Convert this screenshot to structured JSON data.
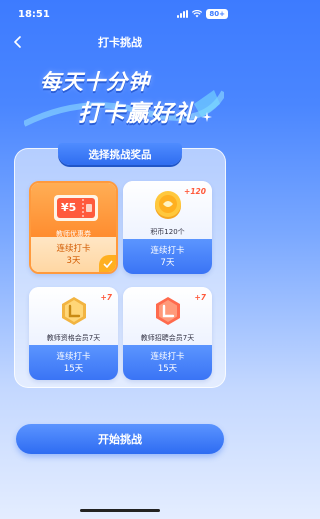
{
  "status_bar": {
    "time": "18:51",
    "battery": "80+"
  },
  "nav": {
    "title": "打卡挑战"
  },
  "banner": {
    "line1": "每天十分钟",
    "line2": "打卡赢好礼"
  },
  "panel": {
    "header": "选择挑战奖品"
  },
  "rewards": [
    {
      "name": "教师优惠券",
      "icon_text": "¥5",
      "streak_label": "连续打卡",
      "days": "3天",
      "plus": "",
      "selected": true
    },
    {
      "name": "积币120个",
      "icon_text": "",
      "streak_label": "连续打卡",
      "days": "7天",
      "plus": "+120",
      "selected": false
    },
    {
      "name": "教师资格会员7天",
      "icon_text": "",
      "streak_label": "连续打卡",
      "days": "15天",
      "plus": "+7",
      "selected": false
    },
    {
      "name": "教师招聘会员7天",
      "icon_text": "",
      "streak_label": "连续打卡",
      "days": "15天",
      "plus": "+7",
      "selected": false
    }
  ],
  "start_button": {
    "label": "开始挑战"
  },
  "colors": {
    "primary": "#3d7bff",
    "accent_orange": "#ff8a2c",
    "gold": "#ffb020"
  }
}
